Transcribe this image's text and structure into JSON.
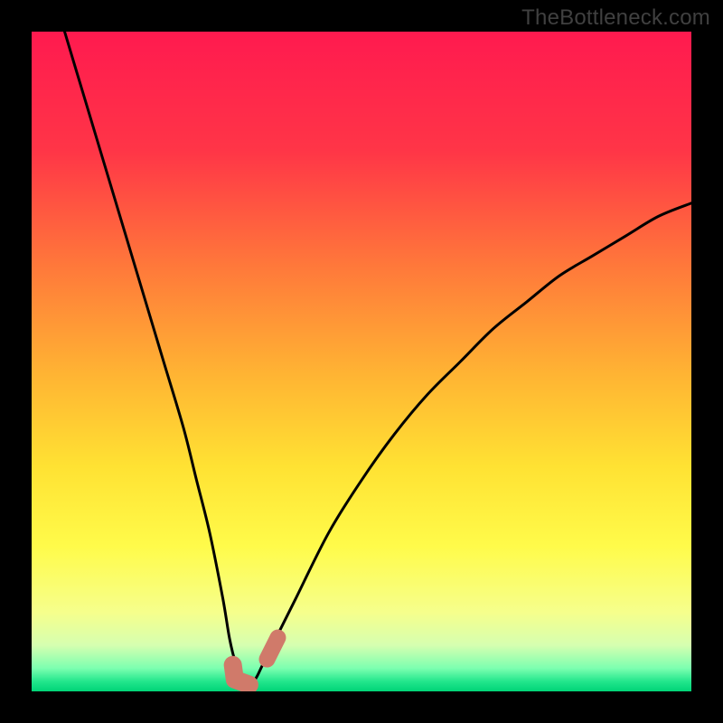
{
  "watermark": {
    "text": "TheBottleneck.com"
  },
  "gradient": {
    "stops": [
      {
        "offset": 0.0,
        "color": "#ff1a4f"
      },
      {
        "offset": 0.18,
        "color": "#ff3547"
      },
      {
        "offset": 0.36,
        "color": "#ff7a3a"
      },
      {
        "offset": 0.52,
        "color": "#ffb433"
      },
      {
        "offset": 0.66,
        "color": "#ffe233"
      },
      {
        "offset": 0.78,
        "color": "#fffb4a"
      },
      {
        "offset": 0.88,
        "color": "#f6ff8c"
      },
      {
        "offset": 0.93,
        "color": "#d6ffb0"
      },
      {
        "offset": 0.965,
        "color": "#7cffb0"
      },
      {
        "offset": 0.985,
        "color": "#22e68c"
      },
      {
        "offset": 1.0,
        "color": "#00d477"
      }
    ]
  },
  "marker_color": "#d07a6a",
  "chart_data": {
    "type": "line",
    "title": "",
    "xlabel": "",
    "ylabel": "",
    "xlim": [
      0,
      100
    ],
    "ylim": [
      0,
      100
    ],
    "series": [
      {
        "name": "bottleneck-curve",
        "x": [
          5,
          8,
          11,
          14,
          17,
          20,
          23,
          25,
          27,
          29,
          30,
          31,
          32,
          33,
          34,
          35,
          37,
          40,
          45,
          50,
          55,
          60,
          65,
          70,
          75,
          80,
          85,
          90,
          95,
          100
        ],
        "values": [
          100,
          90,
          80,
          70,
          60,
          50,
          40,
          32,
          24,
          14,
          8,
          4,
          2,
          1,
          2,
          4,
          8,
          14,
          24,
          32,
          39,
          45,
          50,
          55,
          59,
          63,
          66,
          69,
          72,
          74
        ]
      }
    ],
    "markers": [
      {
        "name": "left-cluster-bottom",
        "x": 30.5,
        "y": 4.0
      },
      {
        "name": "left-cluster-elbow",
        "x": 30.8,
        "y": 1.8
      },
      {
        "name": "left-cluster-tail",
        "x": 33.0,
        "y": 1.0
      },
      {
        "name": "right-dash",
        "x": 36.5,
        "y": 6.5
      }
    ]
  }
}
